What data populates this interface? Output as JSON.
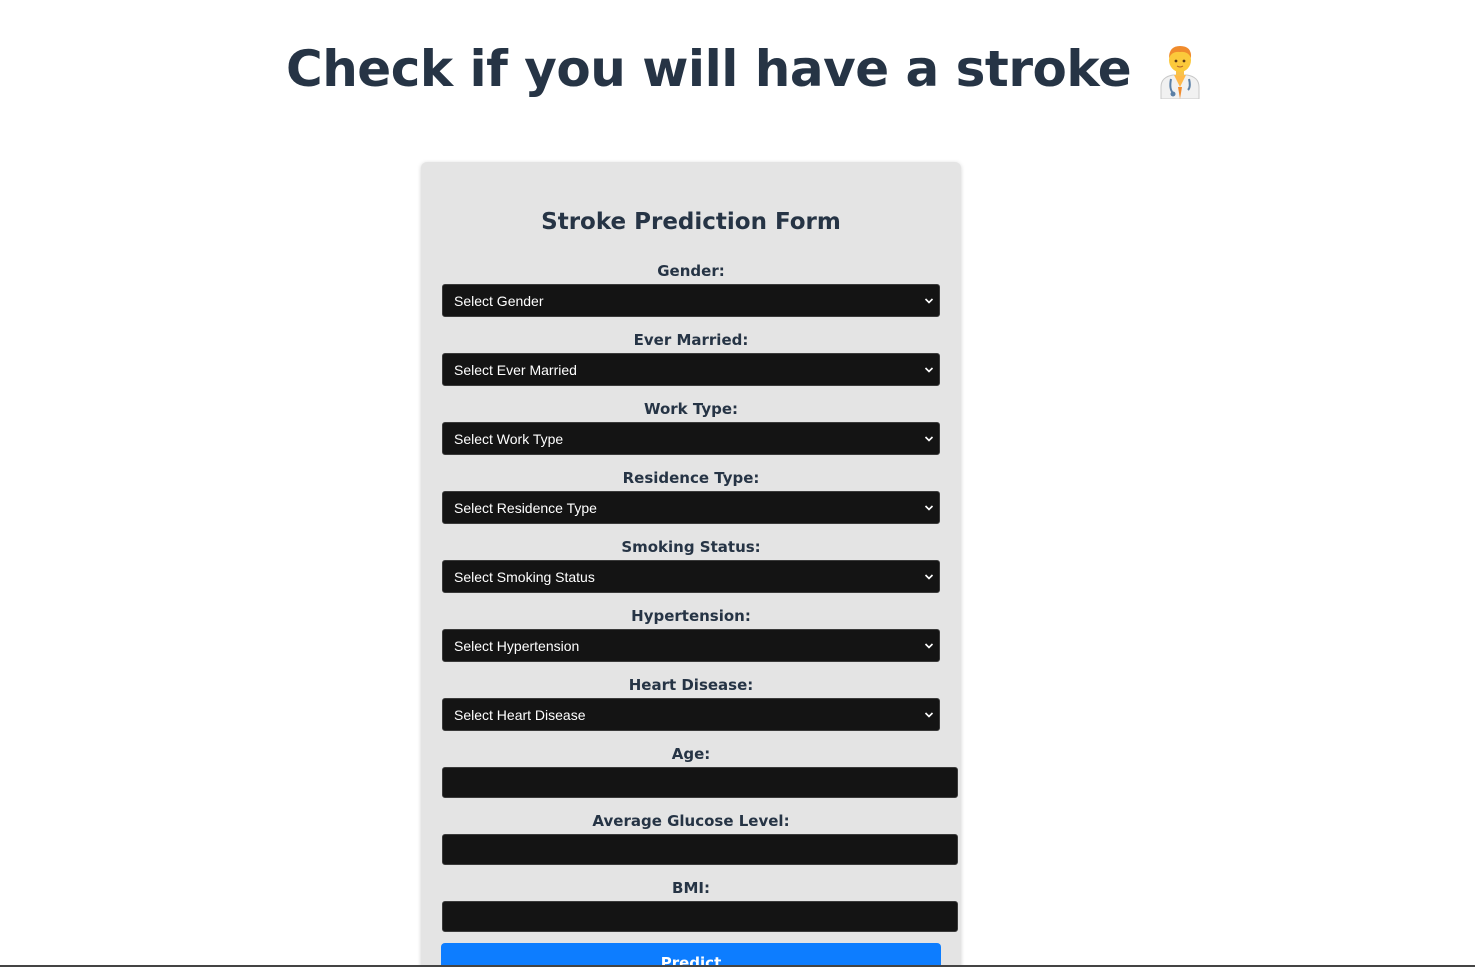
{
  "header": {
    "title": "Check if you will have a stroke",
    "icon": "health-worker-emoji"
  },
  "form": {
    "title": "Stroke Prediction Form",
    "selects": [
      {
        "label": "Gender:",
        "value": "Select Gender"
      },
      {
        "label": "Ever Married:",
        "value": "Select Ever Married"
      },
      {
        "label": "Work Type:",
        "value": "Select Work Type"
      },
      {
        "label": "Residence Type:",
        "value": "Select Residence Type"
      },
      {
        "label": "Smoking Status:",
        "value": "Select Smoking Status"
      },
      {
        "label": "Hypertension:",
        "value": "Select Hypertension"
      },
      {
        "label": "Heart Disease:",
        "value": "Select Heart Disease"
      }
    ],
    "inputs": [
      {
        "label": "Age:",
        "value": ""
      },
      {
        "label": "Average Glucose Level:",
        "value": ""
      },
      {
        "label": "BMI:",
        "value": ""
      }
    ],
    "submit_label": "Predict"
  },
  "colors": {
    "title_text": "#263445",
    "card_bg": "#e4e4e4",
    "field_bg": "#141414",
    "button_bg": "#0d7dff"
  }
}
